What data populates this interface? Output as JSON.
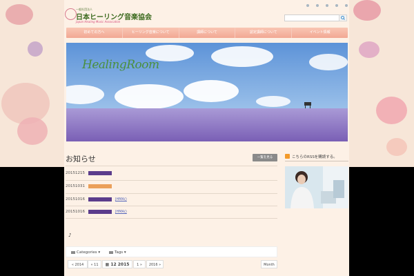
{
  "header": {
    "logo_sub": "一般社団法人",
    "logo_jp": "日本ヒーリング音楽協会",
    "logo_en": "Japan Healing Music Association",
    "search_placeholder": ""
  },
  "nav": {
    "items": [
      "初めての方へ",
      "ヒーリング音楽について",
      "講師について",
      "認定講師について",
      "イベント情報"
    ]
  },
  "hero": {
    "title": "HealingRoom"
  },
  "news": {
    "title": "お知らせ",
    "more_label": "一覧を見る",
    "rows": [
      {
        "date": "20151215",
        "tag_color": "#5b3c8c",
        "link": ""
      },
      {
        "date": "20151031",
        "tag_color": "#eba05a",
        "link": ""
      },
      {
        "date": "20151016",
        "tag_color": "#5b3c8c",
        "link": "JHMA()"
      },
      {
        "date": "20151016",
        "tag_color": "#5b3c8c",
        "link": "JHMA()"
      }
    ],
    "note": "♪"
  },
  "filters": {
    "categories_label": "Categories",
    "tags_label": "Tags"
  },
  "calendar": {
    "prev_year": "« 2014",
    "prev_month": "« 11",
    "current": "12 2015",
    "next_month": "1 »",
    "next_year": "2016 »",
    "view": "Month"
  },
  "sidebar": {
    "rss_label": "こちらのRSSを購読する。"
  },
  "colors": {
    "nav": "#f2a894",
    "page_bg": "#fdf1e6",
    "accent_purple": "#5b3c8c",
    "accent_orange": "#eba05a"
  }
}
